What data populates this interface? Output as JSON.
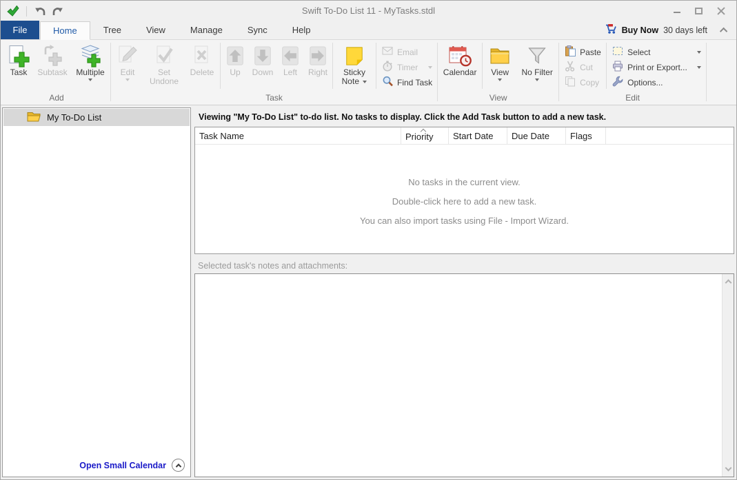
{
  "titlebar": {
    "title": "Swift To-Do List 11 - MyTasks.stdl"
  },
  "tabbar": {
    "file": "File",
    "tabs": [
      {
        "label": "Home",
        "active": true
      },
      {
        "label": "Tree",
        "active": false
      },
      {
        "label": "View",
        "active": false
      },
      {
        "label": "Manage",
        "active": false
      },
      {
        "label": "Sync",
        "active": false
      },
      {
        "label": "Help",
        "active": false
      }
    ],
    "buy_now": "Buy Now",
    "days_left": "30 days left"
  },
  "ribbon": {
    "add_group": {
      "label": "Add",
      "task": "Task",
      "subtask": "Subtask",
      "multiple": "Multiple"
    },
    "task_group": {
      "label": "Task",
      "edit": "Edit",
      "set_undone": "Set Undone",
      "delete": "Delete",
      "up": "Up",
      "down": "Down",
      "left": "Left",
      "right": "Right",
      "sticky_note": "Sticky Note",
      "email": "Email",
      "timer": "Timer",
      "find_task": "Find Task"
    },
    "view_group": {
      "label": "View",
      "calendar": "Calendar",
      "view": "View",
      "no_filter": "No Filter"
    },
    "edit_group": {
      "label": "Edit",
      "paste": "Paste",
      "cut": "Cut",
      "copy": "Copy",
      "select": "Select",
      "print_or_export": "Print or Export...",
      "options": "Options..."
    }
  },
  "sidebar": {
    "items": [
      {
        "label": "My To-Do List",
        "selected": true
      }
    ],
    "open_small_calendar": "Open Small Calendar"
  },
  "main": {
    "status_text": "Viewing \"My To-Do List\" to-do list. No tasks to display. Click the Add Task button to add a new task.",
    "table": {
      "columns": [
        "Task Name",
        "Priority",
        "Start Date",
        "Due Date",
        "Flags"
      ],
      "sort_indicator_column": "Priority",
      "sort_direction": "asc",
      "rows": []
    },
    "empty_state": [
      "No tasks in the current view.",
      "Double-click here to add a new task.",
      "You can also import tasks using File - Import Wizard."
    ],
    "notes_label": "Selected task's notes and attachments:"
  }
}
